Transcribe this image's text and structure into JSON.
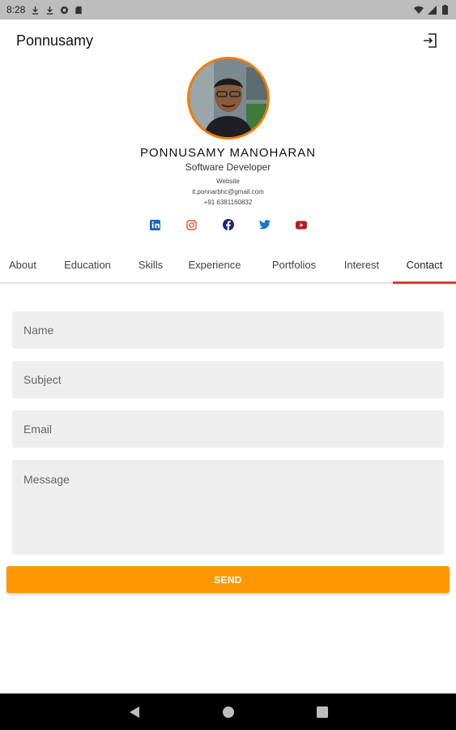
{
  "status_bar": {
    "time": "8:28",
    "icons": [
      "download-icon",
      "download-icon",
      "globe-icon",
      "sim-icon"
    ],
    "right_icons": [
      "wifi-icon",
      "signal-icon",
      "battery-icon"
    ]
  },
  "app_bar": {
    "title": "Ponnusamy",
    "logout_icon": "logout-icon"
  },
  "profile": {
    "name": "PONNUSAMY MANOHARAN",
    "role": "Software Developer",
    "website": "Website",
    "email": "it.ponnarbhc@gmail.com",
    "phone": "+91  6381160832",
    "accent_color": "#f57c00"
  },
  "social": [
    {
      "name": "linkedin-icon",
      "color": "#1565c0"
    },
    {
      "name": "instagram-icon",
      "color": "#e64a19"
    },
    {
      "name": "facebook-icon",
      "color": "#1a237e"
    },
    {
      "name": "twitter-icon",
      "color": "#1976d2"
    },
    {
      "name": "youtube-icon",
      "color": "#b71c1c"
    }
  ],
  "tabs": [
    {
      "label": "About"
    },
    {
      "label": "Education"
    },
    {
      "label": "Skills"
    },
    {
      "label": "Experience"
    },
    {
      "label": "Portfolios"
    },
    {
      "label": "Interest"
    },
    {
      "label": "Contact",
      "active": true
    }
  ],
  "form": {
    "name_placeholder": "Name",
    "subject_placeholder": "Subject",
    "email_placeholder": "Email",
    "message_placeholder": "Message",
    "send_label": "SEND",
    "send_color": "#ff9800"
  },
  "nav_bar": {
    "icons": [
      "back-icon",
      "home-icon",
      "recents-icon"
    ]
  }
}
